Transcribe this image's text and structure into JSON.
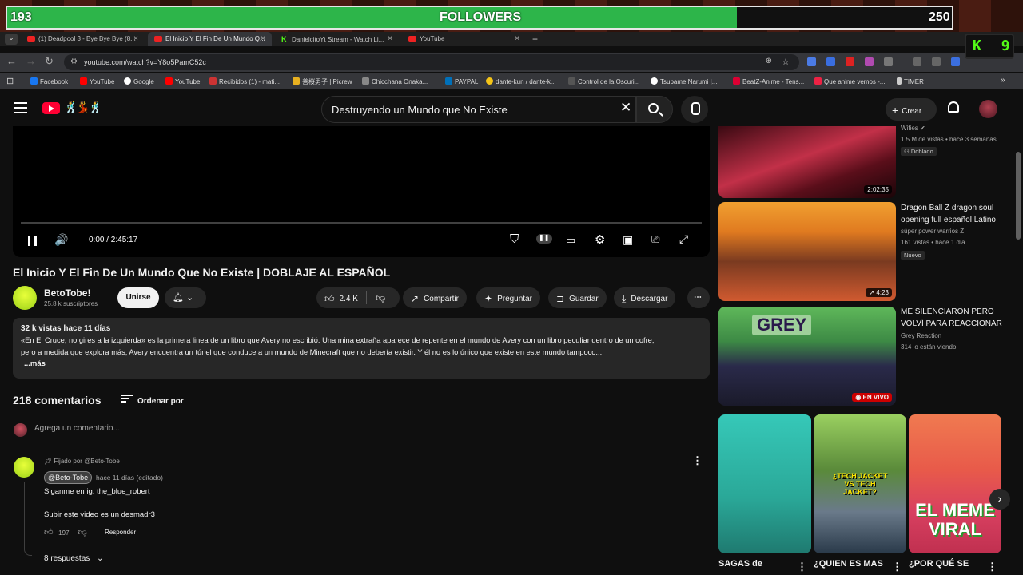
{
  "followers": {
    "current": "193",
    "label": "FOLLOWERS",
    "goal": "250",
    "progress": 0.772,
    "fill_color": "#2db54a"
  },
  "tabs": [
    {
      "label": "(1) Deadpool 3 - Bye Bye Bye (8...",
      "active": false
    },
    {
      "label": "El Inicio Y El Fin De Un Mundo Q...",
      "active": true
    },
    {
      "label": "DanielcitoYt Stream - Watch Li...",
      "active": false
    },
    {
      "label": "YouTube",
      "active": false
    }
  ],
  "browser": {
    "url": "youtube.com/watch?v=Y8o5PamC52c",
    "new_tab": "+"
  },
  "bookmarks": [
    "Facebook",
    "YouTube",
    "Google",
    "YouTube",
    "Recibidos (1) - mati...",
    "善桜男子 | Picrew",
    "Chicchana Onaka...",
    "PAYPAL",
    "dante-kun / dante-k...",
    "Control de la Oscuri...",
    "Tsubame Narumi |...",
    "BeatZ-Anime - Tens...",
    "Que anime vemos -...",
    "TIMER",
    "»"
  ],
  "kick_widget": {
    "letter": "K",
    "count": "9"
  },
  "header": {
    "search_value": "Destruyendo un Mundo que No Existe",
    "create_label": "Crear"
  },
  "player": {
    "time": "0:00 / 2:45:17",
    "progress": 0
  },
  "video": {
    "title": "El Inicio Y El Fin De Un Mundo Que No Existe | DOBLAJE AL ESPAÑOL",
    "channel": "BetoTobe!",
    "subscribers": "25.8 k suscriptores",
    "join_label": "Unirse",
    "likes": "2.4 K",
    "share_label": "Compartir",
    "ask_label": "Preguntar",
    "save_label": "Guardar",
    "download_label": "Descargar",
    "desc_meta": "32 k vistas  hace 11 días",
    "desc_line1": "«En El Cruce, no gires a la izquierda» es la primera linea de un libro que Avery no escribió. Una mina extraña aparece de repente en el mundo de Avery con un libro peculiar dentro de un cofre,",
    "desc_line2": "pero a medida que explora más, Avery encuentra un túnel que conduce a un mundo de Minecraft que no debería existir. Y él no es lo único que existe en este mundo tampoco...",
    "desc_more": "...más"
  },
  "comments": {
    "count": "218 comentarios",
    "sort_label": "Ordenar por",
    "placeholder": "Agrega un comentario...",
    "pinned": {
      "pinned_by": "Fijado por @Beto-Tobe",
      "author": "@Beto-Tobe",
      "when": "hace 11 días (editado)",
      "line1": "Siganme en ig: the_blue_robert",
      "line2": "Subir este video es un desmadr3",
      "likes": "197",
      "reply_label": "Responder",
      "replies_label": "8 respuestas"
    }
  },
  "sidebar": {
    "v0": {
      "channel": "Wifies",
      "meta": "1.5 M de vistas • hace 3 semanas",
      "badge": "Doblado",
      "duration": "2:02:35"
    },
    "v1": {
      "title": "Dragon Ball Z dragon soul opening full español Latino",
      "channel": "súper power warrios Z",
      "meta": "161 vistas • hace 1 día",
      "badge": "Nuevo",
      "duration": "4:23"
    },
    "v2": {
      "title": "ME SILENCIARON PERO VOLVÍ PARA REACCIONAR",
      "channel": "Grey Reaction",
      "meta": "314 lo están viendo",
      "live": "EN VIVO",
      "thumb_text": "GREY"
    },
    "shorts": [
      {
        "title": "SAGAS de"
      },
      {
        "title": "¿QUIEN ES MAS",
        "thumb_text": "¿TECH JACKET VS TECH JACKET?"
      },
      {
        "title": "¿POR QUÉ SE",
        "thumb_text": "EL MEME VIRAL"
      }
    ]
  }
}
